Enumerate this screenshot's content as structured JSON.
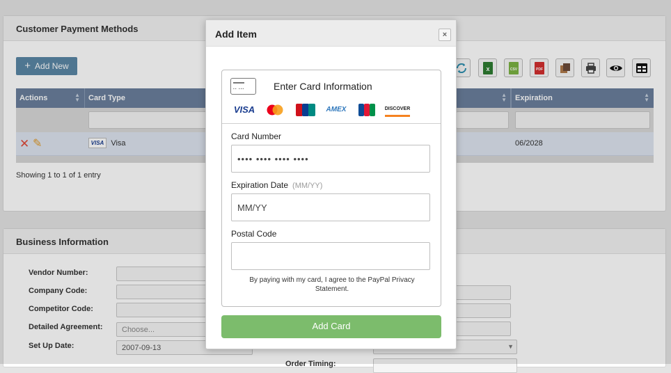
{
  "payment_panel": {
    "title": "Customer Payment Methods",
    "add_new_label": "Add New",
    "columns": [
      {
        "label": "Actions"
      },
      {
        "label": "Card Type"
      },
      {
        "label": ""
      },
      {
        "label": "Expiration"
      }
    ],
    "rows": [
      {
        "card_type": "Visa",
        "card_badge": "VISA",
        "expiration": "06/2028"
      }
    ],
    "showing_text": "Showing 1 to 1 of 1 entry",
    "toolbar_icons": [
      "refresh-icon",
      "excel-icon",
      "csv-icon",
      "pdf-icon",
      "copy-icon",
      "print-icon",
      "eye-icon",
      "columns-icon"
    ]
  },
  "business_panel": {
    "title": "Business Information",
    "fields": [
      {
        "label": "Vendor Number:",
        "value": ""
      },
      {
        "label": "Company Code:",
        "value": ""
      },
      {
        "label": "Competitor Code:",
        "value": ""
      },
      {
        "label": "Detailed Agreement:",
        "value": "",
        "placeholder": "Choose..."
      },
      {
        "label": "Set Up Date:",
        "value": "2007-09-13"
      }
    ],
    "order_timing_label": "Order Timing:"
  },
  "modal": {
    "title": "Add Item",
    "close_glyph": "×",
    "card_header": "Enter Card Information",
    "brands": [
      "VISA",
      "MasterCard",
      "UnionPay",
      "AMEX",
      "JCB",
      "DISCOVER"
    ],
    "card_number_label": "Card Number",
    "card_number_placeholder": "•••• •••• •••• ••••",
    "expiration_label": "Expiration Date",
    "expiration_hint": "(MM/YY)",
    "expiration_placeholder": "MM/YY",
    "postal_label": "Postal Code",
    "postal_placeholder": "",
    "agreement_text": "By paying with my card, I agree to the PayPal Privacy Statement.",
    "submit_label": "Add Card"
  },
  "colors": {
    "header_blue": "#6a7f9c",
    "add_new_blue": "#5b87a6",
    "submit_green": "#7cbc6c"
  }
}
